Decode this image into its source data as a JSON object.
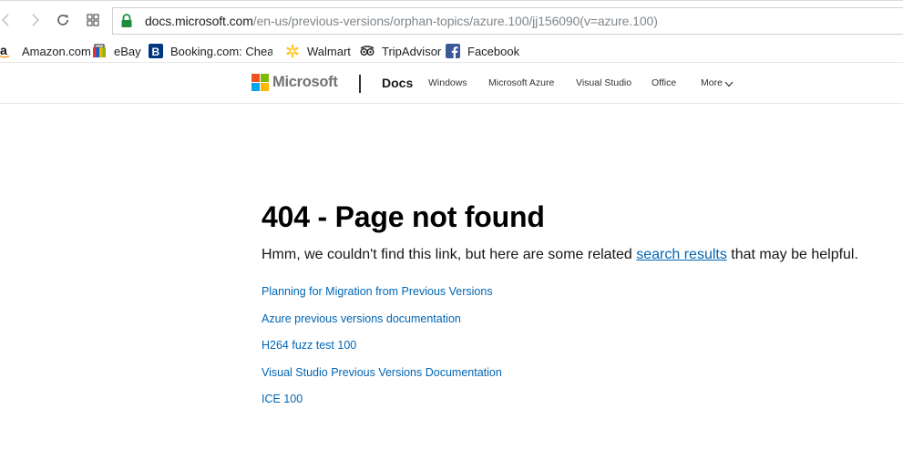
{
  "browser": {
    "url_host": "docs.microsoft.com",
    "url_path": "/en-us/previous-versions/orphan-topics/azure.100/jj156090(v=azure.100)",
    "icons": {
      "back": "back-arrow-icon",
      "forward": "forward-arrow-icon",
      "reload": "reload-icon",
      "apps": "apps-grid-icon",
      "secure": "lock-icon"
    },
    "secure_color": "#1e8e3e"
  },
  "bookmarks": [
    {
      "label": "Amazon.com",
      "icon": "amazon-icon"
    },
    {
      "label": "eBay",
      "icon": "ebay-icon"
    },
    {
      "label": "Booking.com: Cheap",
      "icon": "booking-icon"
    },
    {
      "label": "Walmart",
      "icon": "walmart-icon"
    },
    {
      "label": "TripAdvisor",
      "icon": "tripadvisor-icon"
    },
    {
      "label": "Facebook",
      "icon": "facebook-icon"
    }
  ],
  "header": {
    "brand": "Microsoft",
    "brand_colors": [
      "#f25022",
      "#7fba00",
      "#00a4ef",
      "#ffb900"
    ],
    "section": "Docs",
    "nav": [
      "Windows",
      "Microsoft Azure",
      "Visual Studio",
      "Office",
      "More"
    ]
  },
  "main": {
    "title": "404 - Page not found",
    "lead_before": "Hmm, we couldn't find this link, but here are some related ",
    "lead_link": "search results",
    "lead_after": " that may be helpful.",
    "results": [
      "Planning for Migration from Previous Versions",
      "Azure previous versions documentation",
      "H264 fuzz test 100",
      "Visual Studio Previous Versions Documentation",
      "ICE 100"
    ],
    "link_color": "#0065b3"
  }
}
